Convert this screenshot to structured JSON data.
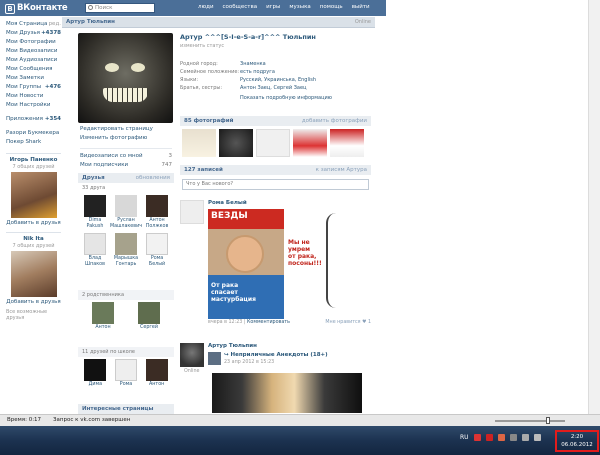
{
  "header": {
    "logo_text": "ВКонтакте",
    "logo_letter": "В",
    "search_placeholder": "Поиск",
    "nav": [
      "люди",
      "сообщества",
      "игры",
      "музыка",
      "помощь",
      "выйти"
    ]
  },
  "sidebar": {
    "items": [
      {
        "label": "Моя Страница",
        "extra": "ред."
      },
      {
        "label": "Мои Друзья",
        "extra": "+4378"
      },
      {
        "label": "Мои Фотографии",
        "extra": ""
      },
      {
        "label": "Мои Видеозаписи",
        "extra": ""
      },
      {
        "label": "Мои Аудиозаписи",
        "extra": ""
      },
      {
        "label": "Мои Сообщения",
        "extra": ""
      },
      {
        "label": "Мои Заметки",
        "extra": ""
      },
      {
        "label": "Мои Группы",
        "extra": "+476"
      },
      {
        "label": "Мои Новости",
        "extra": ""
      },
      {
        "label": "Мои Настройки",
        "extra": ""
      }
    ],
    "apps": {
      "label": "Приложения",
      "extra": "+354"
    },
    "games": [
      "Разори Букмекера",
      "Покер Shark"
    ],
    "friend1": {
      "name": "Игорь Паненко",
      "sub": "7 общих друзей",
      "add": "Добавить в друзья"
    },
    "friend2": {
      "name": "Nik Ita",
      "sub": "7 общих друзей",
      "add": "Добавить в друзья"
    },
    "all_friends": "Все возможные друзья"
  },
  "page": {
    "owner": "Артур Тюльпин",
    "online": "Online"
  },
  "left_actions": {
    "edit_page": "Редактировать страницу",
    "change_photo": "Изменить фотографию",
    "videos_label": "Видеозаписи со мной",
    "videos_count": "3",
    "subscribers_label": "Мои подписчики",
    "subscribers_count": "747"
  },
  "friends_block": {
    "title": "Друзья",
    "action": "обновления",
    "count": "33 друга",
    "items": [
      "Dima\nPakush",
      "Руслан\nМашлакевич",
      "Антон\nПолжков",
      "Влад\nШпаков",
      "Марышка\nГонтарь",
      "Рома\nБелый"
    ]
  },
  "relatives_block": {
    "count": "2 родственника",
    "items": [
      "Антон",
      "Сергей"
    ]
  },
  "school_block": {
    "count": "11 друзей по школе",
    "items": [
      "Дима",
      "Рома",
      "Антон"
    ]
  },
  "interesting": {
    "title": "Интересные страницы"
  },
  "profile": {
    "name": "Артур ^^^[S-I-e-S-a-r]^^^ Тюльпин",
    "status": "изменить статус",
    "info": [
      {
        "key": "Родной город:",
        "value": "Знаменка"
      },
      {
        "key": "Семейное положение:",
        "value": "есть подруга"
      },
      {
        "key": "Языки:",
        "value": "Русский, Украинська, English"
      },
      {
        "key": "Братья, сестры:",
        "value": "Антон Заец, Сергей Заец"
      }
    ],
    "show_more": "Показать подробную информацию"
  },
  "photos": {
    "title": "85 фотографий",
    "action": "добавить фотографии"
  },
  "wall": {
    "title": "127 записей",
    "action": "к записям Артура",
    "input_placeholder": "Что у Вас нового?"
  },
  "post1": {
    "author": "Рома Белый",
    "cover_title": "ВЕЗДЫ",
    "cover_text": "От рака\nспасает\nмастурбация",
    "meme_text": "Мы не\nумрем\nот рака,\nпосоны!!!",
    "date": "вчера в 12:23",
    "comment": "Комментировать",
    "likes": "Мне нравится",
    "likes_count": "1"
  },
  "post2": {
    "author": "Артур Тюльпин",
    "online": "Online",
    "repost_from": "Неприличные Анекдоты (18+)",
    "date": "23 апр 2012 в 15:23"
  },
  "statusbar": {
    "time_label": "Время:  0:17",
    "status": "Запрос к vk.com завершен"
  },
  "taskbar": {
    "lang": "RU",
    "time": "2:20",
    "date": "06.06.2012"
  },
  "colors": {
    "vk_blue": "#4b6f98",
    "link": "#2b587a",
    "highlight": "#e21c1c"
  }
}
